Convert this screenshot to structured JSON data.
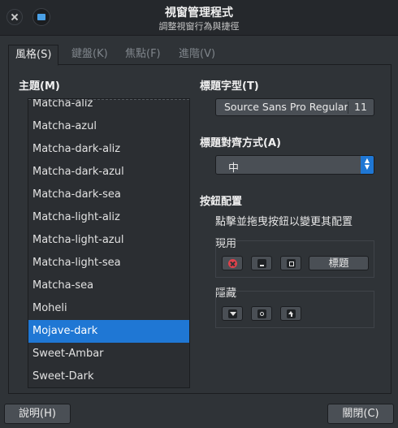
{
  "window": {
    "title": "視窗管理程式",
    "subtitle": "調整視窗行為與捷徑"
  },
  "tabs": [
    {
      "label": "風格(S)",
      "active": true
    },
    {
      "label": "鍵盤(K)",
      "active": false
    },
    {
      "label": "焦點(F)",
      "active": false
    },
    {
      "label": "進階(V)",
      "active": false
    }
  ],
  "theme": {
    "label": "主題(M)",
    "items": [
      "Matcha-aliz",
      "Matcha-azul",
      "Matcha-dark-aliz",
      "Matcha-dark-azul",
      "Matcha-dark-sea",
      "Matcha-light-aliz",
      "Matcha-light-azul",
      "Matcha-light-sea",
      "Matcha-sea",
      "Moheli",
      "Mojave-dark",
      "Sweet-Ambar",
      "Sweet-Dark"
    ],
    "selected": "Mojave-dark"
  },
  "title_font": {
    "label": "標題字型(T)",
    "font_name": "Source Sans Pro Regular",
    "font_size": "11"
  },
  "title_alignment": {
    "label": "標題對齊方式(A)",
    "value": "中"
  },
  "button_layout": {
    "label": "按鈕配置",
    "hint": "點擊並拖曳按鈕以變更其配置",
    "active_label": "現用",
    "hidden_label": "隱藏",
    "title_button_label": "標題"
  },
  "footer": {
    "help_label": "說明(H)",
    "close_label": "關閉(C)"
  },
  "colors": {
    "accent": "#1f77d4",
    "background": "#2f3337",
    "close_red": "#e0414b"
  }
}
